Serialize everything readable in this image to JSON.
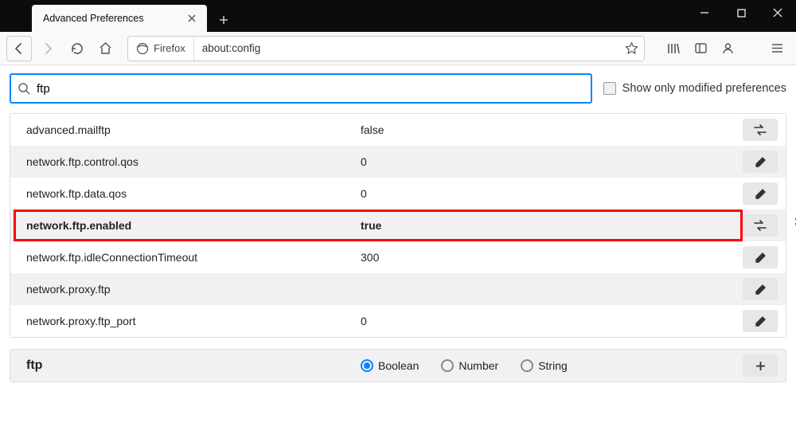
{
  "window": {
    "tab_title": "Advanced Preferences"
  },
  "toolbar": {
    "identity_label": "Firefox",
    "url": "about:config"
  },
  "search": {
    "value": "ftp",
    "checkbox_label": "Show only modified preferences"
  },
  "prefs": [
    {
      "name": "advanced.mailftp",
      "value": "false",
      "action": "toggle",
      "highlighted": false
    },
    {
      "name": "network.ftp.control.qos",
      "value": "0",
      "action": "edit",
      "highlighted": false
    },
    {
      "name": "network.ftp.data.qos",
      "value": "0",
      "action": "edit",
      "highlighted": false
    },
    {
      "name": "network.ftp.enabled",
      "value": "true",
      "action": "toggle",
      "highlighted": true
    },
    {
      "name": "network.ftp.idleConnectionTimeout",
      "value": "300",
      "action": "edit",
      "highlighted": false
    },
    {
      "name": "network.proxy.ftp",
      "value": "",
      "action": "edit",
      "highlighted": false
    },
    {
      "name": "network.proxy.ftp_port",
      "value": "0",
      "action": "edit",
      "highlighted": false
    }
  ],
  "addrow": {
    "name": "ftp",
    "types": {
      "selected": "Boolean",
      "options": [
        "Boolean",
        "Number",
        "String"
      ]
    }
  }
}
